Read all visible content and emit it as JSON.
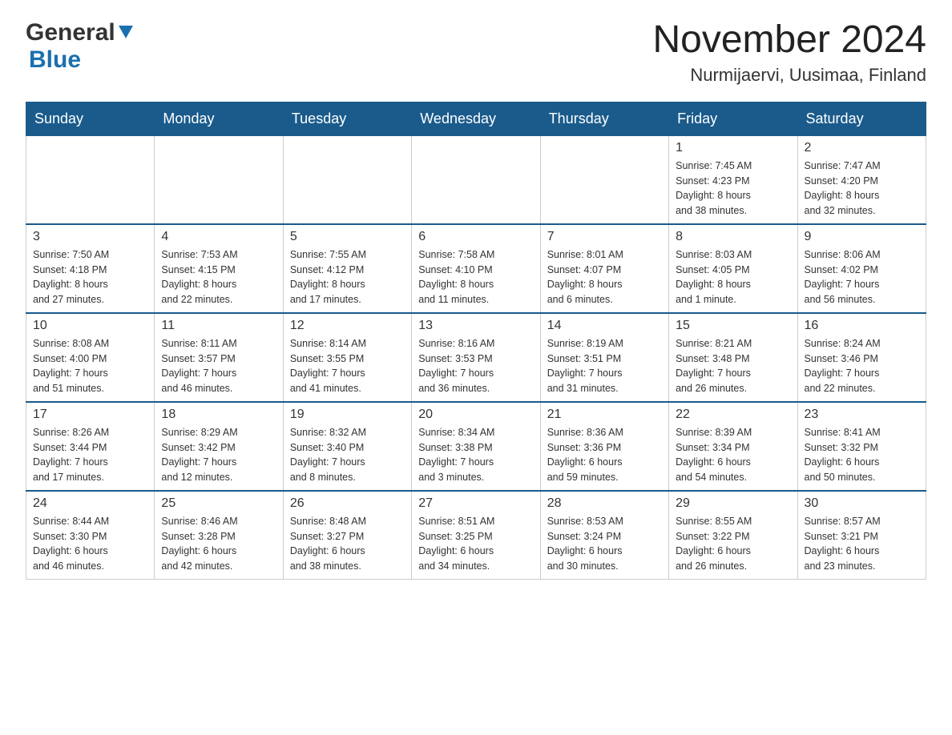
{
  "header": {
    "logo_general": "General",
    "logo_blue": "Blue",
    "month_title": "November 2024",
    "location": "Nurmijaervi, Uusimaa, Finland"
  },
  "weekdays": [
    "Sunday",
    "Monday",
    "Tuesday",
    "Wednesday",
    "Thursday",
    "Friday",
    "Saturday"
  ],
  "weeks": [
    [
      {
        "day": "",
        "info": ""
      },
      {
        "day": "",
        "info": ""
      },
      {
        "day": "",
        "info": ""
      },
      {
        "day": "",
        "info": ""
      },
      {
        "day": "",
        "info": ""
      },
      {
        "day": "1",
        "info": "Sunrise: 7:45 AM\nSunset: 4:23 PM\nDaylight: 8 hours\nand 38 minutes."
      },
      {
        "day": "2",
        "info": "Sunrise: 7:47 AM\nSunset: 4:20 PM\nDaylight: 8 hours\nand 32 minutes."
      }
    ],
    [
      {
        "day": "3",
        "info": "Sunrise: 7:50 AM\nSunset: 4:18 PM\nDaylight: 8 hours\nand 27 minutes."
      },
      {
        "day": "4",
        "info": "Sunrise: 7:53 AM\nSunset: 4:15 PM\nDaylight: 8 hours\nand 22 minutes."
      },
      {
        "day": "5",
        "info": "Sunrise: 7:55 AM\nSunset: 4:12 PM\nDaylight: 8 hours\nand 17 minutes."
      },
      {
        "day": "6",
        "info": "Sunrise: 7:58 AM\nSunset: 4:10 PM\nDaylight: 8 hours\nand 11 minutes."
      },
      {
        "day": "7",
        "info": "Sunrise: 8:01 AM\nSunset: 4:07 PM\nDaylight: 8 hours\nand 6 minutes."
      },
      {
        "day": "8",
        "info": "Sunrise: 8:03 AM\nSunset: 4:05 PM\nDaylight: 8 hours\nand 1 minute."
      },
      {
        "day": "9",
        "info": "Sunrise: 8:06 AM\nSunset: 4:02 PM\nDaylight: 7 hours\nand 56 minutes."
      }
    ],
    [
      {
        "day": "10",
        "info": "Sunrise: 8:08 AM\nSunset: 4:00 PM\nDaylight: 7 hours\nand 51 minutes."
      },
      {
        "day": "11",
        "info": "Sunrise: 8:11 AM\nSunset: 3:57 PM\nDaylight: 7 hours\nand 46 minutes."
      },
      {
        "day": "12",
        "info": "Sunrise: 8:14 AM\nSunset: 3:55 PM\nDaylight: 7 hours\nand 41 minutes."
      },
      {
        "day": "13",
        "info": "Sunrise: 8:16 AM\nSunset: 3:53 PM\nDaylight: 7 hours\nand 36 minutes."
      },
      {
        "day": "14",
        "info": "Sunrise: 8:19 AM\nSunset: 3:51 PM\nDaylight: 7 hours\nand 31 minutes."
      },
      {
        "day": "15",
        "info": "Sunrise: 8:21 AM\nSunset: 3:48 PM\nDaylight: 7 hours\nand 26 minutes."
      },
      {
        "day": "16",
        "info": "Sunrise: 8:24 AM\nSunset: 3:46 PM\nDaylight: 7 hours\nand 22 minutes."
      }
    ],
    [
      {
        "day": "17",
        "info": "Sunrise: 8:26 AM\nSunset: 3:44 PM\nDaylight: 7 hours\nand 17 minutes."
      },
      {
        "day": "18",
        "info": "Sunrise: 8:29 AM\nSunset: 3:42 PM\nDaylight: 7 hours\nand 12 minutes."
      },
      {
        "day": "19",
        "info": "Sunrise: 8:32 AM\nSunset: 3:40 PM\nDaylight: 7 hours\nand 8 minutes."
      },
      {
        "day": "20",
        "info": "Sunrise: 8:34 AM\nSunset: 3:38 PM\nDaylight: 7 hours\nand 3 minutes."
      },
      {
        "day": "21",
        "info": "Sunrise: 8:36 AM\nSunset: 3:36 PM\nDaylight: 6 hours\nand 59 minutes."
      },
      {
        "day": "22",
        "info": "Sunrise: 8:39 AM\nSunset: 3:34 PM\nDaylight: 6 hours\nand 54 minutes."
      },
      {
        "day": "23",
        "info": "Sunrise: 8:41 AM\nSunset: 3:32 PM\nDaylight: 6 hours\nand 50 minutes."
      }
    ],
    [
      {
        "day": "24",
        "info": "Sunrise: 8:44 AM\nSunset: 3:30 PM\nDaylight: 6 hours\nand 46 minutes."
      },
      {
        "day": "25",
        "info": "Sunrise: 8:46 AM\nSunset: 3:28 PM\nDaylight: 6 hours\nand 42 minutes."
      },
      {
        "day": "26",
        "info": "Sunrise: 8:48 AM\nSunset: 3:27 PM\nDaylight: 6 hours\nand 38 minutes."
      },
      {
        "day": "27",
        "info": "Sunrise: 8:51 AM\nSunset: 3:25 PM\nDaylight: 6 hours\nand 34 minutes."
      },
      {
        "day": "28",
        "info": "Sunrise: 8:53 AM\nSunset: 3:24 PM\nDaylight: 6 hours\nand 30 minutes."
      },
      {
        "day": "29",
        "info": "Sunrise: 8:55 AM\nSunset: 3:22 PM\nDaylight: 6 hours\nand 26 minutes."
      },
      {
        "day": "30",
        "info": "Sunrise: 8:57 AM\nSunset: 3:21 PM\nDaylight: 6 hours\nand 23 minutes."
      }
    ]
  ]
}
